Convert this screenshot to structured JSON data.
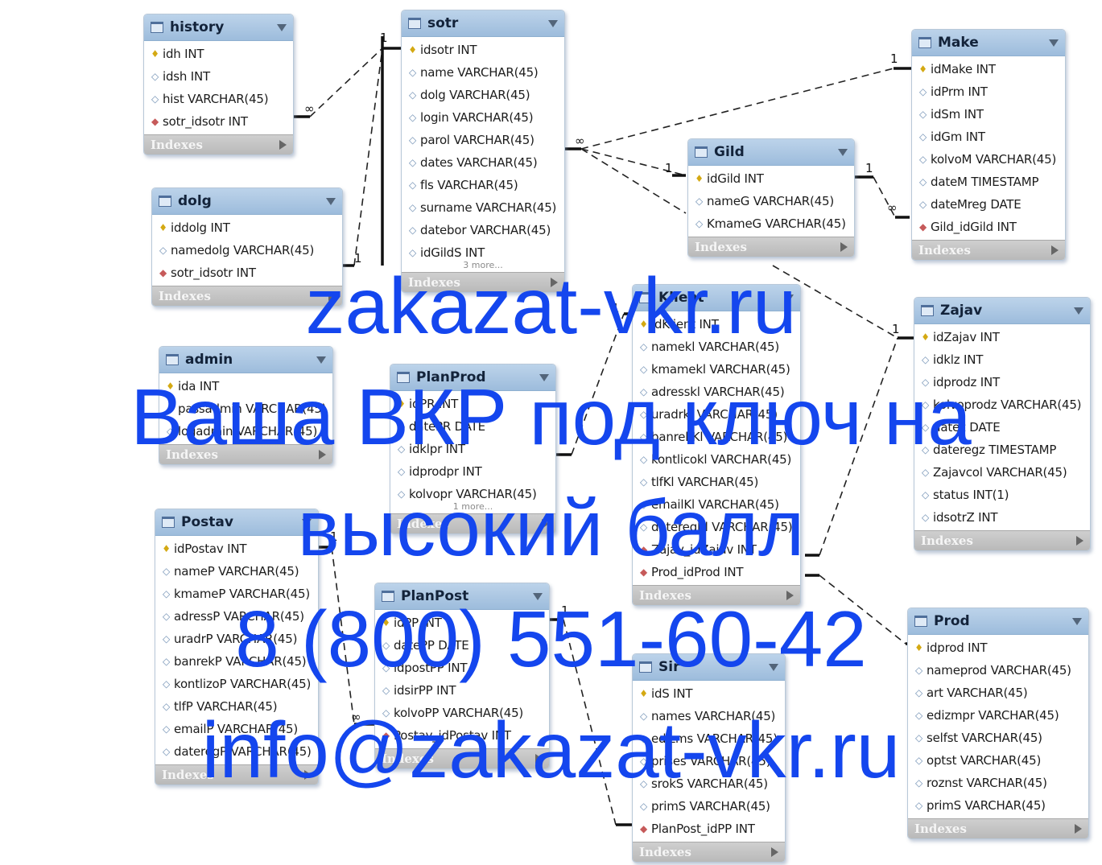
{
  "tables": {
    "history": {
      "name": "history",
      "columns": [
        {
          "kind": "pk",
          "text": "idh INT"
        },
        {
          "kind": "col",
          "text": "idsh INT"
        },
        {
          "kind": "col",
          "text": "hist VARCHAR(45)"
        },
        {
          "kind": "fk",
          "text": "sotr_idsotr INT"
        }
      ],
      "indexes": "Indexes"
    },
    "sotr": {
      "name": "sotr",
      "columns": [
        {
          "kind": "pk",
          "text": "idsotr INT"
        },
        {
          "kind": "col",
          "text": "name VARCHAR(45)"
        },
        {
          "kind": "col",
          "text": "dolg VARCHAR(45)"
        },
        {
          "kind": "col",
          "text": "login VARCHAR(45)"
        },
        {
          "kind": "col",
          "text": "parol VARCHAR(45)"
        },
        {
          "kind": "col",
          "text": "dates VARCHAR(45)"
        },
        {
          "kind": "col",
          "text": "fls VARCHAR(45)"
        },
        {
          "kind": "col",
          "text": "surname VARCHAR(45)"
        },
        {
          "kind": "col",
          "text": "datebor VARCHAR(45)"
        },
        {
          "kind": "col",
          "text": "idGildS INT"
        }
      ],
      "more": "3 more...",
      "indexes": "Indexes"
    },
    "make": {
      "name": "Make",
      "columns": [
        {
          "kind": "pk",
          "text": "idMake INT"
        },
        {
          "kind": "col",
          "text": "idPrm INT"
        },
        {
          "kind": "col",
          "text": "idSm INT"
        },
        {
          "kind": "col",
          "text": "idGm INT"
        },
        {
          "kind": "col",
          "text": "kolvoM VARCHAR(45)"
        },
        {
          "kind": "col",
          "text": "dateM TIMESTAMP"
        },
        {
          "kind": "col",
          "text": "dateMreg DATE"
        },
        {
          "kind": "fk",
          "text": "Gild_idGild INT"
        }
      ],
      "indexes": "Indexes"
    },
    "gild": {
      "name": "Gild",
      "columns": [
        {
          "kind": "pk",
          "text": "idGild INT"
        },
        {
          "kind": "col",
          "text": "nameG VARCHAR(45)"
        },
        {
          "kind": "col",
          "text": "KmameG VARCHAR(45)"
        }
      ],
      "indexes": "Indexes"
    },
    "dolg": {
      "name": "dolg",
      "columns": [
        {
          "kind": "pk",
          "text": "iddolg INT"
        },
        {
          "kind": "col",
          "text": "namedolg VARCHAR(45)"
        },
        {
          "kind": "fk",
          "text": "sotr_idsotr INT"
        }
      ],
      "indexes": "Indexes"
    },
    "klient": {
      "name": "Klient",
      "columns": [
        {
          "kind": "pk",
          "text": "idKlient INT"
        },
        {
          "kind": "col",
          "text": "namekl VARCHAR(45)"
        },
        {
          "kind": "col",
          "text": "kmamekl VARCHAR(45)"
        },
        {
          "kind": "col",
          "text": "adresskl VARCHAR(45)"
        },
        {
          "kind": "col",
          "text": "uradrkl VARCHAR(45)"
        },
        {
          "kind": "col",
          "text": "banrekKl VARCHAR(45)"
        },
        {
          "kind": "col",
          "text": "kontlicokl VARCHAR(45)"
        },
        {
          "kind": "col",
          "text": "tlfKl VARCHAR(45)"
        },
        {
          "kind": "col",
          "text": "emailKl VARCHAR(45)"
        },
        {
          "kind": "col",
          "text": "dateregKl VARCHAR(45)"
        },
        {
          "kind": "fk",
          "text": "Zajav_idZajav INT"
        },
        {
          "kind": "fk",
          "text": "Prod_idProd INT"
        }
      ],
      "indexes": "Indexes"
    },
    "zajav": {
      "name": "Zajav",
      "columns": [
        {
          "kind": "pk",
          "text": "idZajav INT"
        },
        {
          "kind": "col",
          "text": "idklz INT"
        },
        {
          "kind": "col",
          "text": "idprodz INT"
        },
        {
          "kind": "col",
          "text": "kolvoprodz VARCHAR(45)"
        },
        {
          "kind": "col",
          "text": "datez DATE"
        },
        {
          "kind": "col",
          "text": "dateregz TIMESTAMP"
        },
        {
          "kind": "col",
          "text": "Zajavcol VARCHAR(45)"
        },
        {
          "kind": "col",
          "text": "status INT(1)"
        },
        {
          "kind": "col",
          "text": "idsotrZ INT"
        }
      ],
      "indexes": "Indexes"
    },
    "admin": {
      "name": "admin",
      "columns": [
        {
          "kind": "pk",
          "text": "ida INT"
        },
        {
          "kind": "col",
          "text": "passadmin VARCHAR(45)"
        },
        {
          "kind": "col",
          "text": "logadmin VARCHAR(45)"
        }
      ],
      "indexes": "Indexes"
    },
    "planprod": {
      "name": "PlanProd",
      "columns": [
        {
          "kind": "pk",
          "text": "idPR INT"
        },
        {
          "kind": "col",
          "text": "datePR DATE"
        },
        {
          "kind": "col",
          "text": "idklpr INT"
        },
        {
          "kind": "col",
          "text": "idprodpr INT"
        },
        {
          "kind": "col",
          "text": "kolvopr VARCHAR(45)"
        }
      ],
      "more": "1 more...",
      "indexes": "Indexes"
    },
    "postav": {
      "name": "Postav",
      "columns": [
        {
          "kind": "pk",
          "text": "idPostav INT"
        },
        {
          "kind": "col",
          "text": "nameP VARCHAR(45)"
        },
        {
          "kind": "col",
          "text": "kmameP VARCHAR(45)"
        },
        {
          "kind": "col",
          "text": "adressP VARCHAR(45)"
        },
        {
          "kind": "col",
          "text": "uradrP VARCHAR(45)"
        },
        {
          "kind": "col",
          "text": "banrekP VARCHAR(45)"
        },
        {
          "kind": "col",
          "text": "kontlizoP VARCHAR(45)"
        },
        {
          "kind": "col",
          "text": "tlfP VARCHAR(45)"
        },
        {
          "kind": "col",
          "text": "emailP VARCHAR(45)"
        },
        {
          "kind": "col",
          "text": "dateregP VARCHAR(45)"
        }
      ],
      "indexes": "Indexes"
    },
    "planpost": {
      "name": "PlanPost",
      "columns": [
        {
          "kind": "pk",
          "text": "idPP INT"
        },
        {
          "kind": "col",
          "text": "datePP DATE"
        },
        {
          "kind": "col",
          "text": "idpostPP INT"
        },
        {
          "kind": "col",
          "text": "idsirPP INT"
        },
        {
          "kind": "col",
          "text": "kolvoPP VARCHAR(45)"
        },
        {
          "kind": "fk",
          "text": "Postav_idPostav INT"
        }
      ],
      "indexes": "Indexes"
    },
    "sir": {
      "name": "Sir",
      "columns": [
        {
          "kind": "pk",
          "text": "idS INT"
        },
        {
          "kind": "col",
          "text": "names VARCHAR(45)"
        },
        {
          "kind": "col",
          "text": "edizms VARCHAR(45)"
        },
        {
          "kind": "col",
          "text": "prises VARCHAR(45)"
        },
        {
          "kind": "col",
          "text": "srokS VARCHAR(45)"
        },
        {
          "kind": "col",
          "text": "primS VARCHAR(45)"
        },
        {
          "kind": "fk",
          "text": "PlanPost_idPP INT"
        }
      ],
      "indexes": "Indexes"
    },
    "prod": {
      "name": "Prod",
      "columns": [
        {
          "kind": "pk",
          "text": "idprod INT"
        },
        {
          "kind": "col",
          "text": "nameprod VARCHAR(45)"
        },
        {
          "kind": "col",
          "text": "art VARCHAR(45)"
        },
        {
          "kind": "col",
          "text": "edizmpr VARCHAR(45)"
        },
        {
          "kind": "col",
          "text": "selfst VARCHAR(45)"
        },
        {
          "kind": "col",
          "text": "optst VARCHAR(45)"
        },
        {
          "kind": "col",
          "text": "roznst VARCHAR(45)"
        },
        {
          "kind": "col",
          "text": "primS VARCHAR(45)"
        }
      ],
      "indexes": "Indexes"
    }
  },
  "cardinalities": {
    "history_sotr_one": "1",
    "history_sotr_many": "∞",
    "dolg_sotr_one": "1",
    "sotr_gild_many": "∞",
    "sotr_gild_one": "1",
    "make_one": "1",
    "gild_make_one": "1",
    "gild_make_many": "∞",
    "zajav_one": "1",
    "klient_one": "1",
    "postav_one": "1",
    "postav_many": "∞",
    "planpost_one": "1"
  },
  "watermark": [
    "zakazat-vkr.ru",
    "Ваша ВКР под ключ на",
    "высокий балл",
    "8 (800) 551-60-42",
    "info@zakazat-vkr.ru"
  ]
}
